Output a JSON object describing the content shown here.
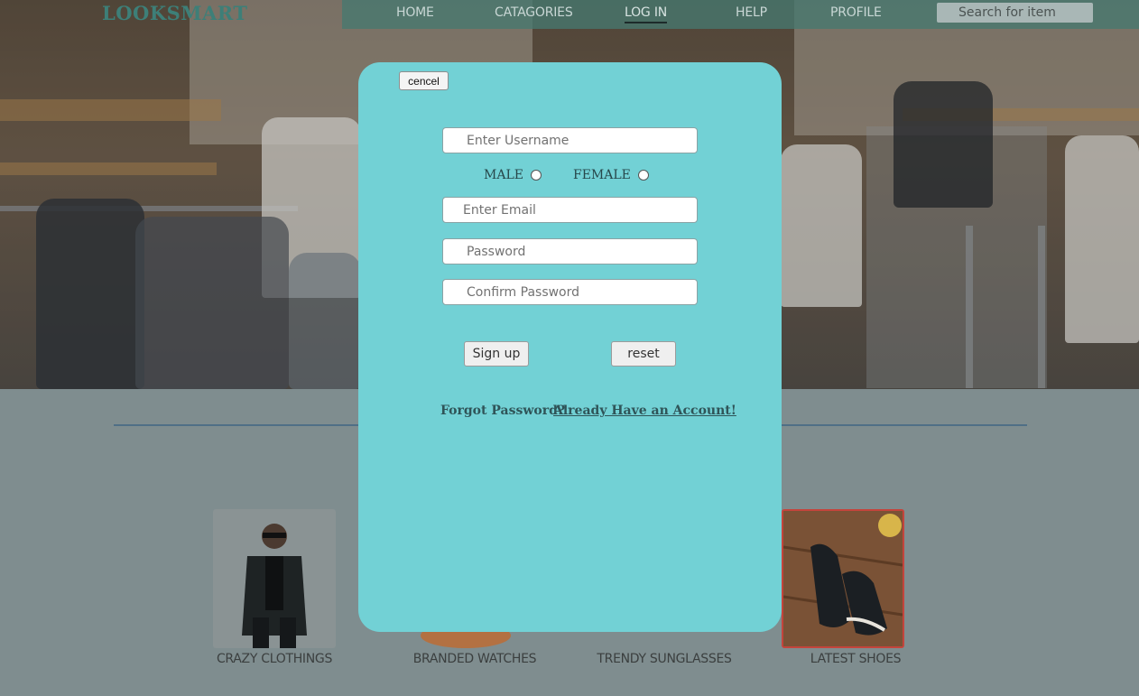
{
  "header": {
    "logo": "LOOKSMART",
    "nav": [
      {
        "label": "HOME"
      },
      {
        "label": "CATAGORIES"
      },
      {
        "label": "LOG IN",
        "active": true
      },
      {
        "label": "HELP"
      },
      {
        "label": "PROFILE"
      }
    ],
    "search_placeholder": "Search for item"
  },
  "modal": {
    "cancel_label": "cencel",
    "username_placeholder": "Enter Username",
    "gender": {
      "male": "MALE",
      "female": "FEMALE"
    },
    "email_placeholder": "Enter Email",
    "password_placeholder": "Password",
    "confirm_placeholder": "Confirm Password",
    "signup_label": "Sign up",
    "reset_label": "reset",
    "forgot_label": "Forgot Password?",
    "already_label": "Already Have an Account!"
  },
  "categories": [
    {
      "label": "CRAZY CLOTHINGS"
    },
    {
      "label": "BRANDED WATCHES"
    },
    {
      "label": "TRENDY SUNGLASSES"
    },
    {
      "label": "LATEST SHOES"
    }
  ],
  "colors": {
    "modal_bg": "#72d1d5",
    "logo": "#3d7f78",
    "navbar": "#467870"
  }
}
